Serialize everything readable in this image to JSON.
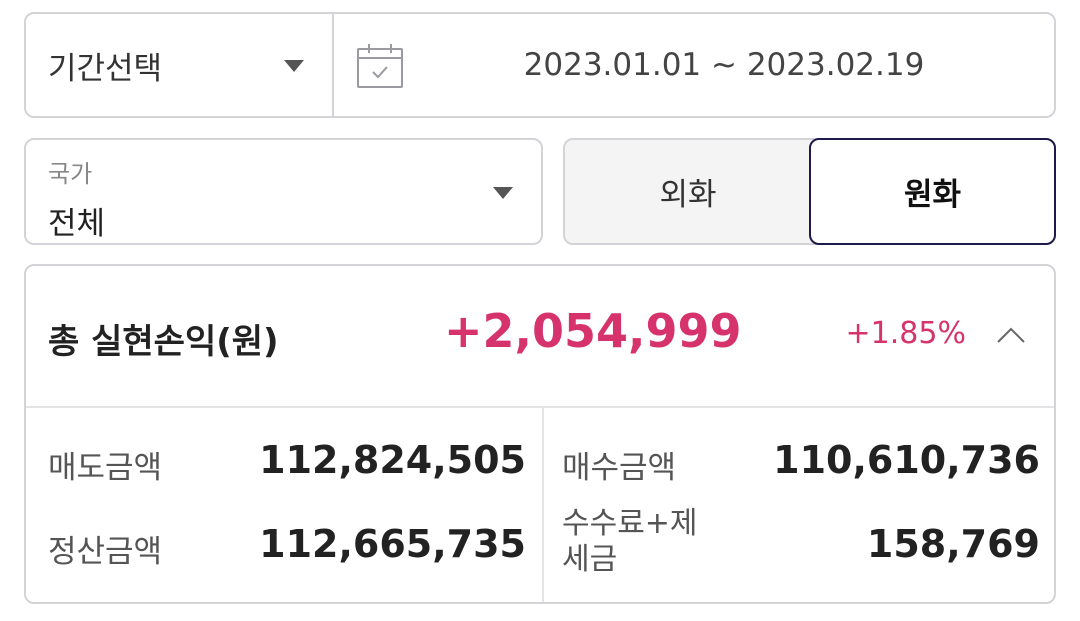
{
  "period": {
    "label": "기간선택",
    "date_range": "2023.01.01 ~ 2023.02.19",
    "calendar_icon": "calendar-icon"
  },
  "country": {
    "label": "국가",
    "value": "전체"
  },
  "currency_toggle": {
    "foreign_label": "외화",
    "krw_label": "원화",
    "selected": "원화"
  },
  "summary": {
    "title": "총 실현손익(원)",
    "amount": "+2,054,999",
    "rate": "+1.85%",
    "collapse_icon": "chevron-up-icon",
    "sell_label": "매도금액",
    "sell_value": "112,824,505",
    "buy_label": "매수금액",
    "buy_value": "110,610,736",
    "settle_label": "정산금액",
    "settle_value": "112,665,735",
    "fee_label": "수수료+제세금",
    "fee_value": "158,769"
  },
  "colors": {
    "accent_positive": "#d6336c",
    "selected_border": "#1e1b4b",
    "border": "#d4d4d8"
  }
}
